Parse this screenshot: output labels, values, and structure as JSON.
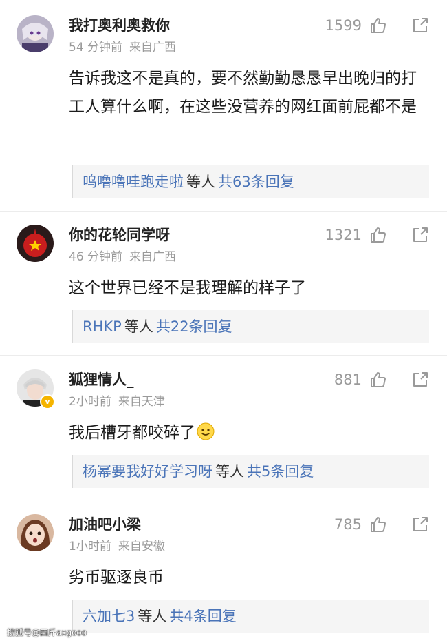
{
  "comments": [
    {
      "username": "我打奥利奥救你",
      "time": "54 分钟前",
      "location": "来自广西",
      "likes": "1599",
      "content": "告诉我这不是真的，要不然勤勤恳恳早出晚归的打工人算什么啊，在这些没营养的网红面前屁都不是",
      "reply_user": "呜噜噜哇跑走啦",
      "reply_mid": "等人",
      "reply_count": "共63条回复"
    },
    {
      "username": "你的花轮同学呀",
      "time": "46 分钟前",
      "location": "来自广西",
      "likes": "1321",
      "content": "这个世界已经不是我理解的样子了",
      "reply_user": "RHKP",
      "reply_mid": "等人",
      "reply_count": "共22条回复"
    },
    {
      "username": "狐狸情人_",
      "time": "2小时前",
      "location": "来自天津",
      "likes": "881",
      "content": "我后槽牙都咬碎了",
      "reply_user": "杨幂要我好好学习呀",
      "reply_mid": "等人",
      "reply_count": "共5条回复"
    },
    {
      "username": "加油吧小梁",
      "time": "1小时前",
      "location": "来自安徽",
      "likes": "785",
      "content": "劣币驱逐良币",
      "reply_user": "六加七3",
      "reply_mid": "等人",
      "reply_count": "共4条回复"
    }
  ],
  "icons": {
    "like": "thumbs-up-icon",
    "share": "share-icon",
    "emoji": "smile-emoji-icon",
    "verified": "verified-badge-icon"
  },
  "colors": {
    "link": "#4a74b8",
    "muted": "#9a9a9a",
    "text": "#1c1c1c",
    "verified": "#f5b400"
  },
  "watermark": "搜狐号@四斤axgooo"
}
